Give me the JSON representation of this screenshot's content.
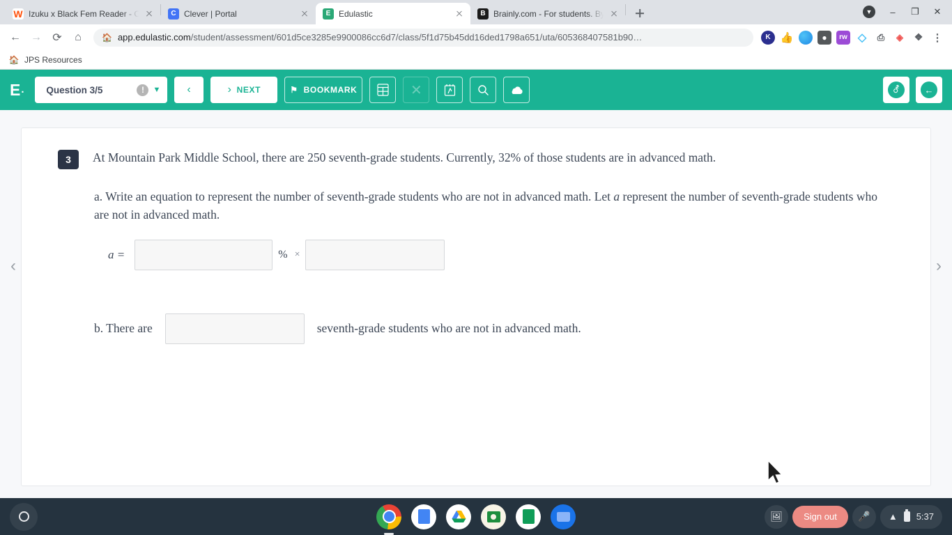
{
  "browser": {
    "tabs": [
      {
        "title": "Izuku x Black Fem Reader - Chap",
        "favicon": "wattpad-icon",
        "active": false
      },
      {
        "title": "Clever | Portal",
        "favicon": "clever-icon",
        "active": false
      },
      {
        "title": "Edulastic",
        "favicon": "edulastic-icon",
        "active": true
      },
      {
        "title": "Brainly.com - For students. By st",
        "favicon": "brainly-icon",
        "active": false
      }
    ],
    "new_tab_label": "+",
    "window_controls": {
      "minimize": "–",
      "maximize": "❐",
      "close": "✕"
    },
    "nav": {
      "back": "←",
      "forward": "→",
      "reload": "⟳",
      "home": "⌂"
    },
    "omnibox": {
      "site_icon": "site-info-icon",
      "domain": "app.edulastic.com",
      "path": "/student/assessment/601d5ce3285e9900086cc6d7/class/5f1d75b45dd16ded1798a651/uta/605368407581b90…"
    },
    "extensions": [
      {
        "name": "kami-extension-icon",
        "glyph": "K"
      },
      {
        "name": "thumbs-up-extension-icon",
        "glyph": "👍"
      },
      {
        "name": "screencastify-extension-icon",
        "glyph": ""
      },
      {
        "name": "read-aloud-extension-icon",
        "glyph": "●"
      },
      {
        "name": "readwrite-extension-icon",
        "glyph": "rw"
      },
      {
        "name": "diamond-extension-icon",
        "glyph": "◆"
      },
      {
        "name": "print-extension-icon",
        "glyph": "⎙"
      },
      {
        "name": "video-extension-icon",
        "glyph": "▶"
      },
      {
        "name": "puzzle-extensions-icon",
        "glyph": "🧩"
      },
      {
        "name": "chrome-menu-icon",
        "glyph": "⋮"
      }
    ],
    "bookmarks": [
      {
        "label": "JPS Resources",
        "icon": "folder-site-icon"
      }
    ]
  },
  "app": {
    "logo": "E",
    "logo_dot": "·",
    "question_selector": {
      "label": "Question 3/5",
      "warning_glyph": "!",
      "chevron": "⌄"
    },
    "prev_button": {
      "glyph": "‹"
    },
    "next_button": {
      "glyph": "›",
      "label": "NEXT"
    },
    "bookmark_button": {
      "glyph": "⚑",
      "label": "BOOKMARK"
    },
    "tools": [
      {
        "name": "calculator-icon",
        "glyph": "☷"
      },
      {
        "name": "strikethrough-icon",
        "glyph": "✕"
      },
      {
        "name": "scratchpad-icon",
        "glyph": "✎"
      },
      {
        "name": "magnify-icon",
        "glyph": "⚲"
      },
      {
        "name": "cloud-upload-icon",
        "glyph": "☁"
      }
    ],
    "right_tools": [
      {
        "name": "accessibility-icon",
        "glyph": "♿"
      },
      {
        "name": "exit-test-icon",
        "glyph": "←"
      }
    ],
    "nav_left_glyph": "‹",
    "nav_right_glyph": "›"
  },
  "question": {
    "number": "3",
    "stem": "At Mountain Park Middle School, there are 250 seventh-grade students.  Currently, 32% of those students are in advanced math.",
    "part_a": {
      "text_before_var": "a.  Write an equation to represent the number of seventh-grade students who are not in advanced math.  Let ",
      "variable": "a",
      "text_after_var": " represent the number of seventh-grade students who are not in advanced math.",
      "equation_lhs": "a =",
      "input1_value": "",
      "percent_symbol": "%",
      "times_symbol": "×",
      "input2_value": ""
    },
    "part_b": {
      "label": "b.  There are",
      "input_value": "",
      "trailing_text": "seventh-grade students who are not in advanced math."
    }
  },
  "shelf": {
    "launcher": "launcher-icon",
    "apps": [
      {
        "name": "chrome-app-icon",
        "label": "Chrome"
      },
      {
        "name": "google-docs-app-icon",
        "label": "Docs"
      },
      {
        "name": "google-drive-app-icon",
        "label": "Drive"
      },
      {
        "name": "google-classroom-app-icon",
        "label": "Classroom"
      },
      {
        "name": "google-sheets-app-icon",
        "label": "Sheets"
      },
      {
        "name": "files-app-icon",
        "label": "Files"
      }
    ],
    "screenshot_icon": "screen-capture-icon",
    "sign_out_label": "Sign out",
    "microphone_icon": "microphone-icon",
    "status": {
      "wifi": "▲",
      "battery": "battery-icon",
      "time": "5:37"
    }
  },
  "colors": {
    "app_teal": "#1ab394",
    "badge_navy": "#2b3446",
    "sign_out": "#ec8a83",
    "shelf": "#25333f"
  }
}
